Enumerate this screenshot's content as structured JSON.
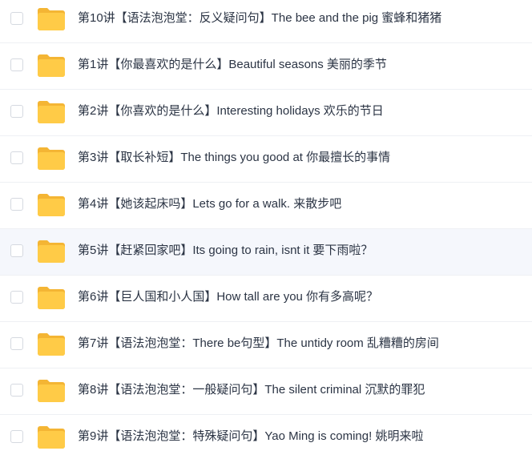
{
  "files": [
    {
      "name": "第10讲【语法泡泡堂：反义疑问句】The bee and the pig 蜜蜂和猪猪",
      "icon": "folder-icon"
    },
    {
      "name": "第1讲【你最喜欢的是什么】Beautiful seasons 美丽的季节",
      "icon": "folder-icon"
    },
    {
      "name": "第2讲【你喜欢的是什么】Interesting holidays 欢乐的节日",
      "icon": "folder-icon"
    },
    {
      "name": "第3讲【取长补短】The things you good at 你最擅长的事情",
      "icon": "folder-icon"
    },
    {
      "name": "第4讲【她该起床吗】Lets go for a walk. 来散步吧",
      "icon": "folder-icon"
    },
    {
      "name": "第5讲【赶紧回家吧】Its going to rain, isnt it 要下雨啦？",
      "icon": "folder-icon"
    },
    {
      "name": "第6讲【巨人国和小人国】How tall are you 你有多高呢？",
      "icon": "folder-icon"
    },
    {
      "name": "第7讲【语法泡泡堂：There be句型】The untidy room 乱糟糟的房间",
      "icon": "folder-icon"
    },
    {
      "name": "第8讲【语法泡泡堂：一般疑问句】The silent criminal 沉默的罪犯",
      "icon": "folder-icon"
    },
    {
      "name": "第9讲【语法泡泡堂：特殊疑问句】Yao Ming is coming! 姚明来啦",
      "icon": "folder-icon"
    }
  ],
  "colors": {
    "folder": "#ffcb47",
    "folder_tab": "#f4b534",
    "text": "#2b3444",
    "hover_row": "#f5f7fc",
    "divider": "#eef0f4",
    "checkbox_border": "#d5d9e0"
  }
}
